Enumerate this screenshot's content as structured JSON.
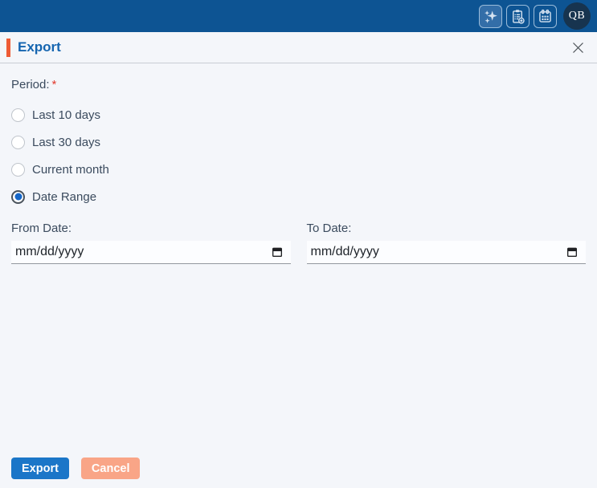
{
  "topbar": {
    "icons": [
      {
        "name": "sparkles"
      },
      {
        "name": "clipboard-add"
      },
      {
        "name": "calendar"
      }
    ],
    "avatar_initials": "QB"
  },
  "header": {
    "title": "Export"
  },
  "form": {
    "period_label": "Period:",
    "required_marker": "*",
    "options": [
      {
        "label": "Last 10 days",
        "selected": false
      },
      {
        "label": "Last 30 days",
        "selected": false
      },
      {
        "label": "Current month",
        "selected": false
      },
      {
        "label": "Date Range",
        "selected": true
      }
    ],
    "from_date": {
      "label": "From Date:",
      "value": "",
      "placeholder": "mm/dd/yyyy"
    },
    "to_date": {
      "label": "To Date:",
      "value": "",
      "placeholder": "mm/dd/yyyy"
    }
  },
  "footer": {
    "export_label": "Export",
    "cancel_label": "Cancel"
  },
  "colors": {
    "topbar_bg": "#0d5493",
    "accent_orange": "#ee5b35",
    "title_blue": "#1565b0",
    "primary_button": "#1b76c8",
    "cancel_button": "#f9a587",
    "radio_selected": "#1667c8",
    "required_red": "#e23b2e",
    "page_bg": "#f4f6fa"
  }
}
